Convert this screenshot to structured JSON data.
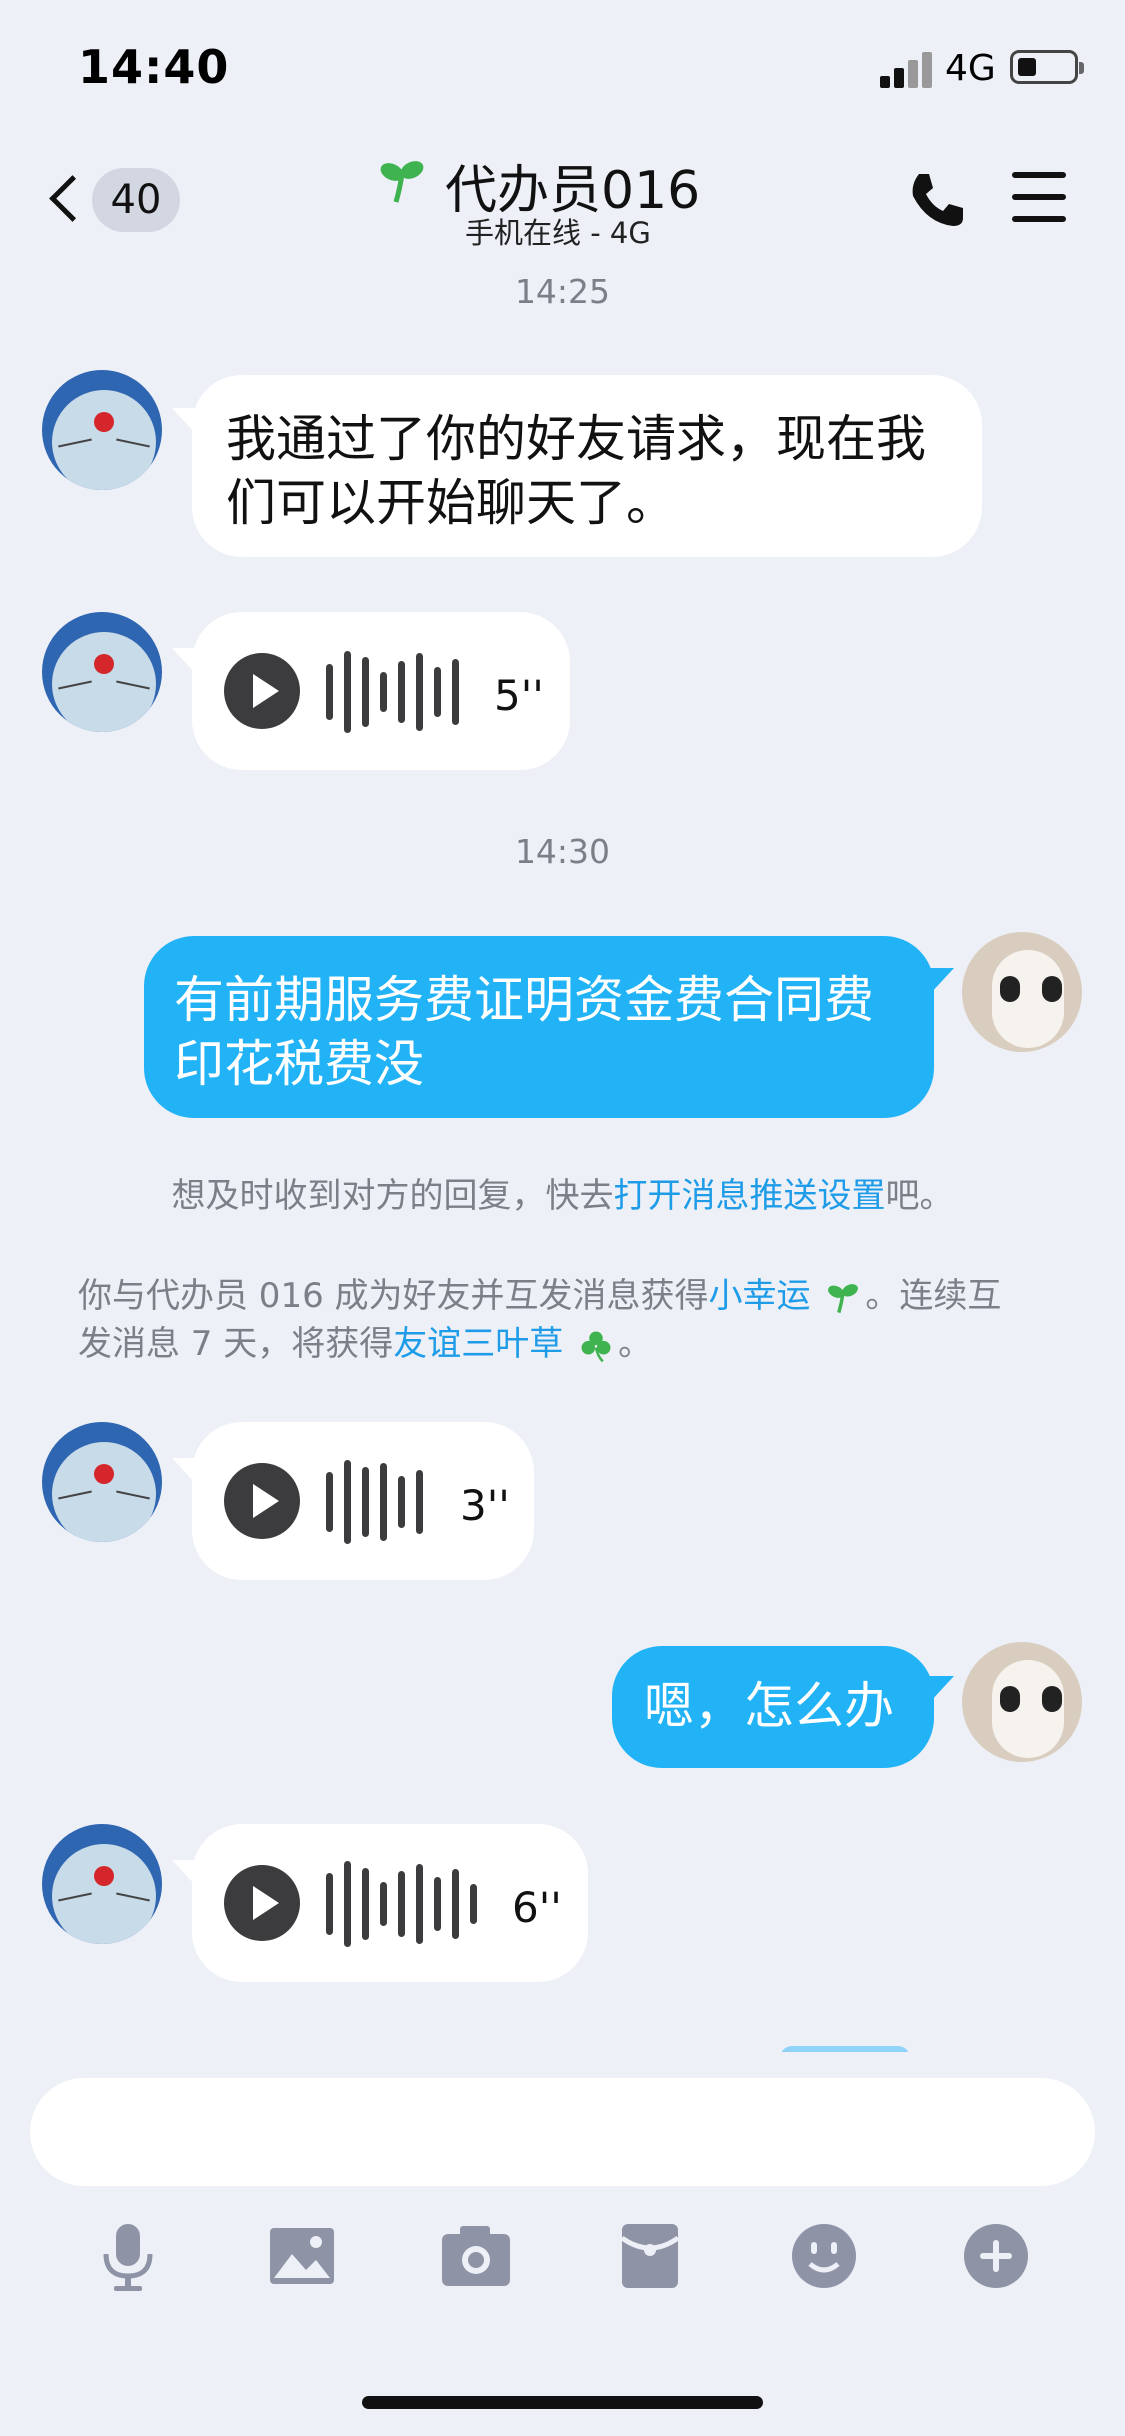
{
  "status": {
    "time": "14:40",
    "network": "4G"
  },
  "header": {
    "back_count": "40",
    "title": "代办员016",
    "subtitle": "手机在线 - 4G"
  },
  "messages": {
    "ts1": "14:25",
    "m1_text": "我通过了你的好友请求，现在我们可以开始聊天了。",
    "m2_duration": "5''",
    "ts2": "14:30",
    "m3_text": "有前期服务费证明资金费合同费印花税费没",
    "m4_duration": "3''",
    "m5_text": "嗯，怎么办",
    "m6_duration": "6''"
  },
  "system": {
    "push_prefix": "想及时收到对方的回复，快去",
    "push_link": "打开消息推送设置",
    "push_suffix": "吧。",
    "friend_prefix": "你与代办员 016 成为好友并互发消息获得",
    "friend_link1": "小幸运",
    "friend_mid1": "。连续互",
    "friend_mid2": "发消息 7 天，将获得",
    "friend_link2": "友谊三叶草",
    "friend_suffix": "。"
  },
  "input": {
    "placeholder": ""
  },
  "icons": {
    "accent": "#22b3f7",
    "link": "#1f9ce8",
    "tool_color": "#8e94a6"
  }
}
